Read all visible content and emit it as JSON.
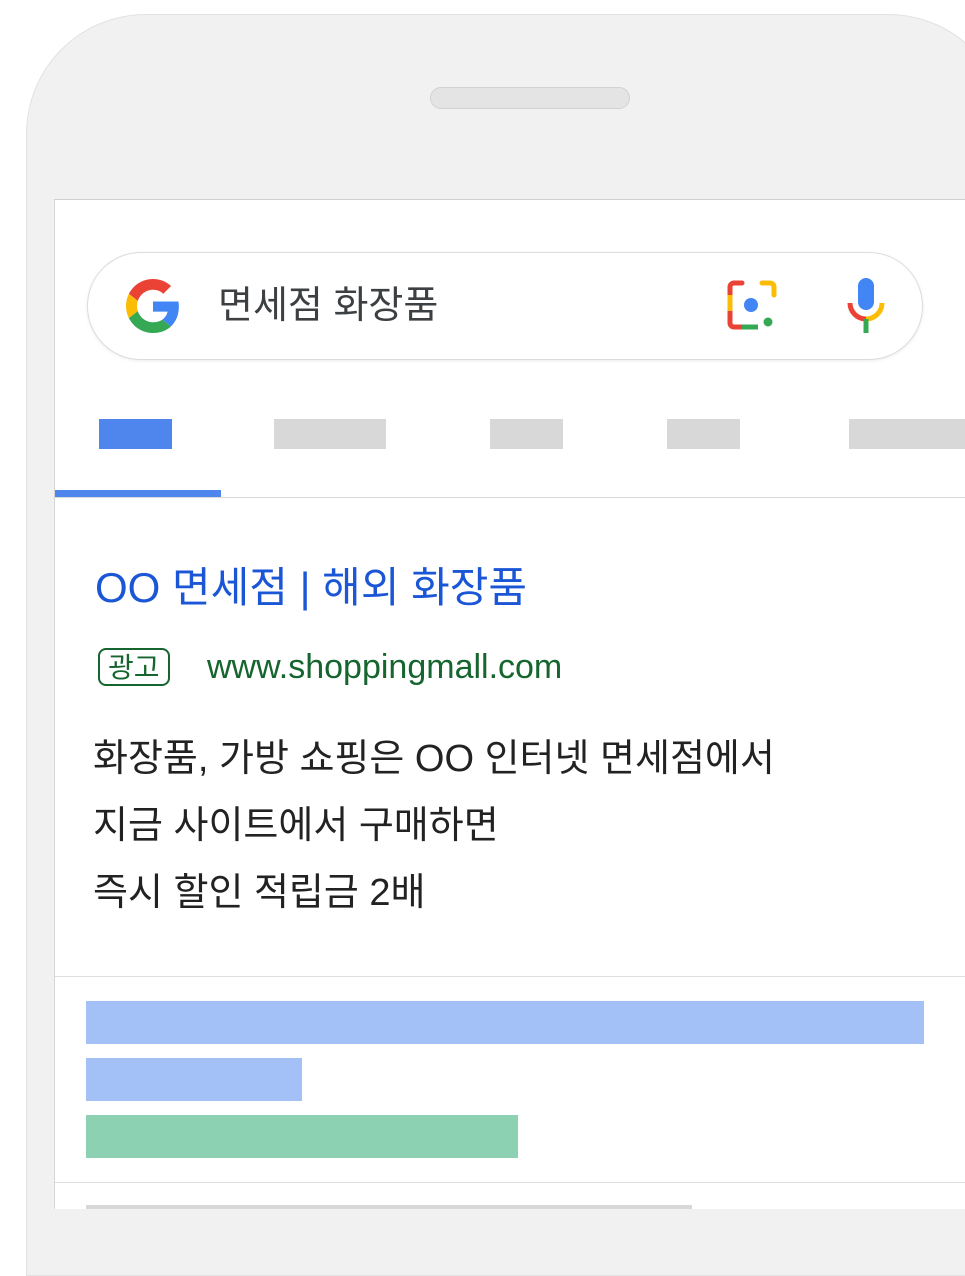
{
  "search": {
    "query": "면세점 화장품",
    "logo_icon": "google-g-icon",
    "lens_icon": "google-lens-icon",
    "mic_icon": "microphone-icon"
  },
  "tabs": [
    {
      "active": true
    },
    {
      "active": false
    },
    {
      "active": false
    },
    {
      "active": false
    },
    {
      "active": false
    }
  ],
  "ad": {
    "title": "OO 면세점 | 해외 화장품",
    "badge": "광고",
    "url": "www.shoppingmall.com",
    "description": [
      "화장품, 가방 쇼핑은 OO 인터넷 면세점에서",
      "지금 사이트에서 구매하면",
      "즉시 할인 적립금 2배"
    ]
  },
  "colors": {
    "accent_blue": "#4f86ee",
    "link_blue": "#1a56d6",
    "url_green": "#16652e",
    "placeholder_blue": "#a3c1f7",
    "placeholder_green": "#8cd2b2",
    "placeholder_gray": "#d8d8d8"
  }
}
